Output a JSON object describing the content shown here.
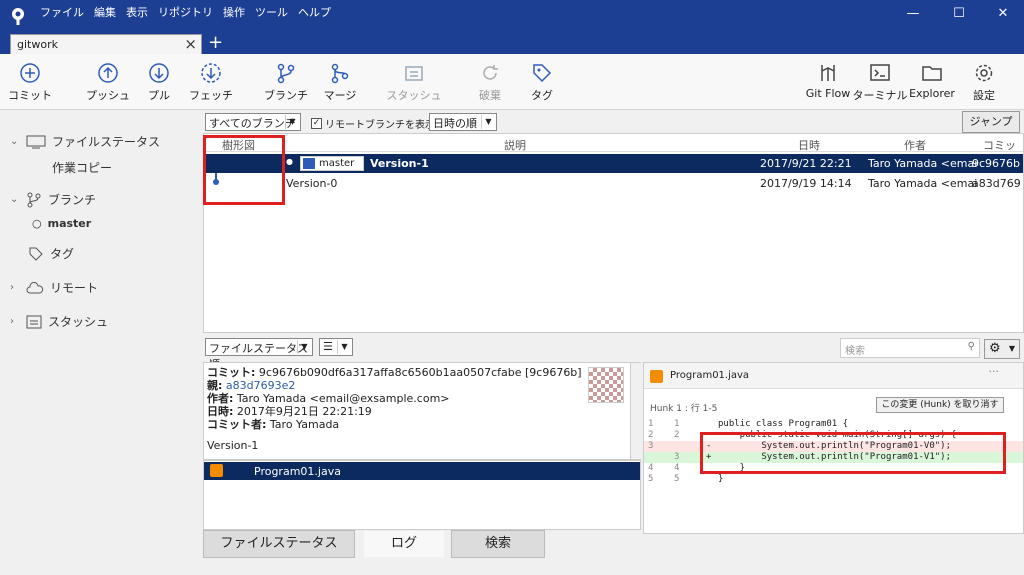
{
  "window": {
    "menu": [
      "ファイル",
      "編集",
      "表示",
      "リポジトリ",
      "操作",
      "ツール",
      "ヘルプ"
    ],
    "tab_title": "gitwork"
  },
  "toolbar": {
    "commit": "コミット",
    "push": "プッシュ",
    "pull": "プル",
    "fetch": "フェッチ",
    "branch": "ブランチ",
    "merge": "マージ",
    "stash": "スタッシュ",
    "discard": "破棄",
    "tag": "タグ",
    "gitflow": "Git Flow",
    "terminal": "ターミナル",
    "explorer": "Explorer",
    "settings": "設定"
  },
  "sidebar": {
    "file_status": "ファイルステータス",
    "working_copy": "作業コピー",
    "branches": "ブランチ",
    "master": "master",
    "tags": "タグ",
    "remotes": "リモート",
    "stashes": "スタッシュ"
  },
  "filter": {
    "branch_select": "すべてのブランチ",
    "show_remote": "リモートブランチを表示",
    "order_select": "日時の順",
    "jump": "ジャンプ先:"
  },
  "log": {
    "headers": {
      "graph": "樹形図",
      "description": "説明",
      "date": "日時",
      "author": "作者",
      "commit": "コミット"
    },
    "rows": [
      {
        "branch": "master",
        "message": "Version-1",
        "date": "2017/9/21 22:21",
        "author": "Taro Yamada <emai",
        "hash": "9c9676b"
      },
      {
        "message": "Version-0",
        "date": "2017/9/19 14:14",
        "author": "Taro Yamada <emai",
        "hash": "a83d769"
      }
    ]
  },
  "lower": {
    "file_sort": "ファイルステータス順",
    "search_placeholder": "検索"
  },
  "commit_info": {
    "commit_label": "コミット:",
    "commit_value": "9c9676b090df6a317affa8c6560b1aa0507cfabe [9c9676b]",
    "parent_label": "親:",
    "parent_value": "a83d7693e2",
    "author_label": "作者:",
    "author_value": "Taro Yamada <email@exsample.com>",
    "date_label": "日時:",
    "date_value": "2017年9月21日 22:21:19",
    "committer_label": "コミット者:",
    "committer_value": "Taro Yamada",
    "message": "Version-1"
  },
  "files": [
    {
      "name": "Program01.java"
    }
  ],
  "bottom_tabs": {
    "file_status": "ファイルステータス",
    "log": "ログ",
    "search": "検索"
  },
  "diff": {
    "file": "Program01.java",
    "hunk": "Hunk 1 : 行 1-5",
    "discard_hunk": "この変更 (Hunk) を取り消す",
    "lines": [
      {
        "o": "1",
        "n": "1",
        "sign": "",
        "text": "public class Program01 {",
        "kind": "ctx"
      },
      {
        "o": "2",
        "n": "2",
        "sign": "",
        "text": "    public static void main(String[] args) {",
        "kind": "ctx"
      },
      {
        "o": "3",
        "n": "",
        "sign": "-",
        "text": "        System.out.println(\"Program01-V0\");",
        "kind": "rem"
      },
      {
        "o": "",
        "n": "3",
        "sign": "+",
        "text": "        System.out.println(\"Program01-V1\");",
        "kind": "add"
      },
      {
        "o": "4",
        "n": "4",
        "sign": "",
        "text": "    }",
        "kind": "ctx"
      },
      {
        "o": "5",
        "n": "5",
        "sign": "",
        "text": "}",
        "kind": "ctx"
      }
    ]
  },
  "colors": {
    "titlebar": "#1c3f94",
    "selection": "#0d2a5e",
    "highlight": "#e02020"
  }
}
